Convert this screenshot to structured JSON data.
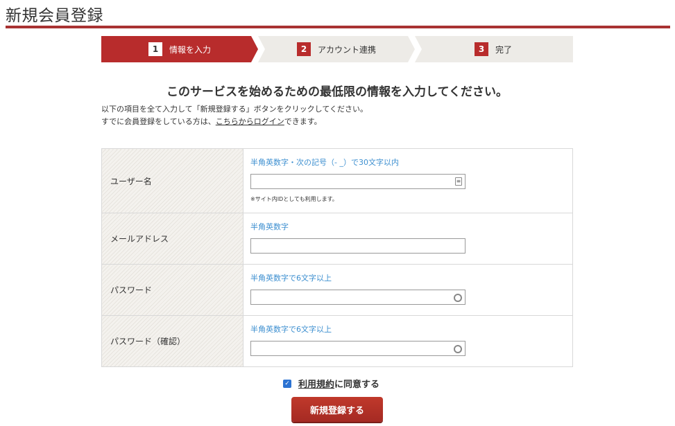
{
  "page": {
    "title": "新規会員登録"
  },
  "steps": [
    {
      "num": "1",
      "label": "情報を入力"
    },
    {
      "num": "2",
      "label": "アカウント連携"
    },
    {
      "num": "3",
      "label": "完了"
    }
  ],
  "headline": "このサービスを始めるための最低限の情報を入力してください。",
  "intro": {
    "line1": "以下の項目を全て入力して「新規登録する」ボタンをクリックしてください。",
    "line2_prefix": "すでに会員登録をしている方は、",
    "login_link": "こちらからログイン",
    "line2_suffix": "できます。"
  },
  "form": {
    "username": {
      "label": "ユーザー名",
      "hint": "半角英数字・次の記号（- _）で30文字以内",
      "value": "",
      "note": "※サイト内IDとしても利用します。"
    },
    "email": {
      "label": "メールアドレス",
      "hint": "半角英数字",
      "value": ""
    },
    "password": {
      "label": "パスワード",
      "hint": "半角英数字で6文字以上",
      "value": ""
    },
    "password_confirm": {
      "label": "パスワード（確認）",
      "hint": "半角英数字で6文字以上",
      "value": ""
    }
  },
  "agree": {
    "terms_link": "利用規約",
    "suffix": "に同意する",
    "checked": true
  },
  "submit": {
    "label": "新規登録する"
  },
  "colors": {
    "accent": "#b82c2c",
    "hint": "#3d8fd0",
    "checkbox": "#2c73d2"
  }
}
